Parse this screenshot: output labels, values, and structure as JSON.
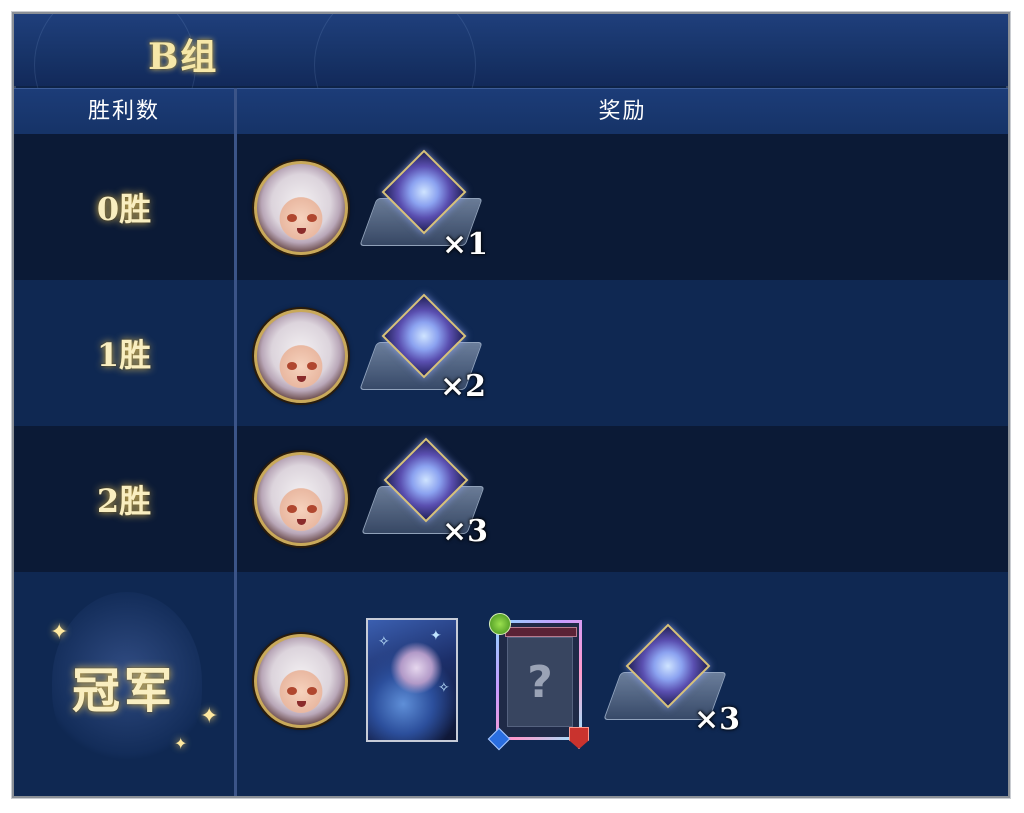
{
  "title": "B组",
  "headers": {
    "wins": "胜利数",
    "rewards": "奖励"
  },
  "rows": [
    {
      "wins_label": "0胜",
      "crystal_qty": "×1"
    },
    {
      "wins_label": "1胜",
      "crystal_qty": "×2"
    },
    {
      "wins_label": "2胜",
      "crystal_qty": "×3"
    },
    {
      "wins_label": "冠军",
      "crystal_qty": "×3"
    }
  ],
  "icons": {
    "avatar": "character-avatar-icon",
    "crystal": "crystal-icon",
    "card": "character-card-icon",
    "mystery": "mystery-card-icon"
  },
  "mystery_symbol": "?",
  "colors": {
    "title_gold": "#f6e7a8",
    "panel_blue": "#0e2347",
    "row_dark": "#0b1a36",
    "row_light": "#0f2852"
  }
}
